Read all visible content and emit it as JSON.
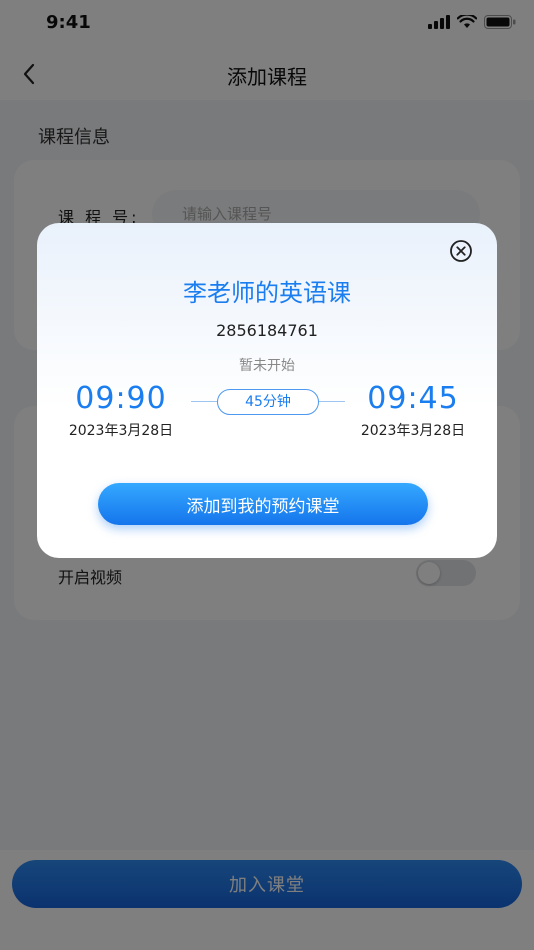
{
  "status_bar": {
    "time": "9:41"
  },
  "nav": {
    "title": "添加课程"
  },
  "section": {
    "title": "课程信息"
  },
  "form": {
    "course_no_label": "课 程 号:",
    "course_no_placeholder": "请输入课程号",
    "video_label": "开启视频",
    "video_enabled": false
  },
  "bottom": {
    "join_label": "加入课堂"
  },
  "modal": {
    "title": "李老师的英语课",
    "course_id": "2856184761",
    "status": "暂未开始",
    "start_time": "09:90",
    "start_date": "2023年3月28日",
    "duration": "45分钟",
    "end_time": "09:45",
    "end_date": "2023年3月28日",
    "add_label": "添加到我的预约课堂"
  },
  "colors": {
    "accent": "#1a7df0",
    "mask": "rgba(0,0,0,0.5)"
  }
}
